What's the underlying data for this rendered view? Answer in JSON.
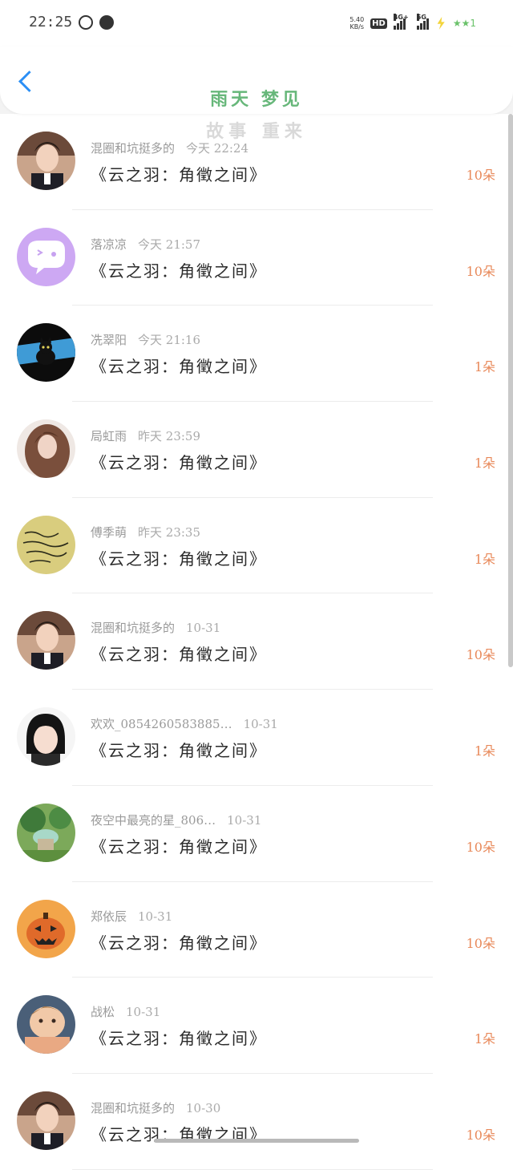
{
  "status_bar": {
    "time": "22:25",
    "speed_value": "5.40",
    "speed_unit": "KB/s",
    "hd": "HD",
    "net1": "4G+",
    "net2": "5G",
    "stars": "★★1"
  },
  "header": {
    "watermark_line1": "雨天 梦见",
    "watermark_line2": "故事 重来"
  },
  "colors": {
    "accent_back": "#2b8ff5",
    "count": "#e8895a",
    "watermark": "#67b77a"
  },
  "rows": [
    {
      "name": "混圈和坑挺多的",
      "time": "今天 22:24",
      "title": "《云之羽：角徵之间》",
      "count": "10朵",
      "avatar": "male-portrait"
    },
    {
      "name": "落凉凉",
      "time": "今天 21:57",
      "title": "《云之羽：角徵之间》",
      "count": "10朵",
      "avatar": "purple-chat"
    },
    {
      "name": "冼翠阳",
      "time": "今天 21:16",
      "title": "《云之羽：角徵之间》",
      "count": "1朵",
      "avatar": "black-cat"
    },
    {
      "name": "局虹雨",
      "time": "昨天 23:59",
      "title": "《云之羽：角徵之间》",
      "count": "1朵",
      "avatar": "girl-portrait"
    },
    {
      "name": "傅季萌",
      "time": "昨天 23:35",
      "title": "《云之羽：角徵之间》",
      "count": "1朵",
      "avatar": "handwriting"
    },
    {
      "name": "混圈和坑挺多的",
      "time": "10-31",
      "title": "《云之羽：角徵之间》",
      "count": "10朵",
      "avatar": "male-portrait"
    },
    {
      "name": "欢欢_0854260583885…",
      "time": "10-31",
      "title": "《云之羽：角徵之间》",
      "count": "1朵",
      "avatar": "child-portrait"
    },
    {
      "name": "夜空中最亮的星_806…",
      "time": "10-31",
      "title": "《云之羽：角徵之间》",
      "count": "10朵",
      "avatar": "garden-scene"
    },
    {
      "name": "郑依辰",
      "time": "10-31",
      "title": "《云之羽：角徵之间》",
      "count": "10朵",
      "avatar": "pumpkin"
    },
    {
      "name": "战松",
      "time": "10-31",
      "title": "《云之羽：角徵之间》",
      "count": "1朵",
      "avatar": "baby-portrait"
    },
    {
      "name": "混圈和坑挺多的",
      "time": "10-30",
      "title": "《云之羽：角徵之间》",
      "count": "10朵",
      "avatar": "male-portrait"
    }
  ]
}
